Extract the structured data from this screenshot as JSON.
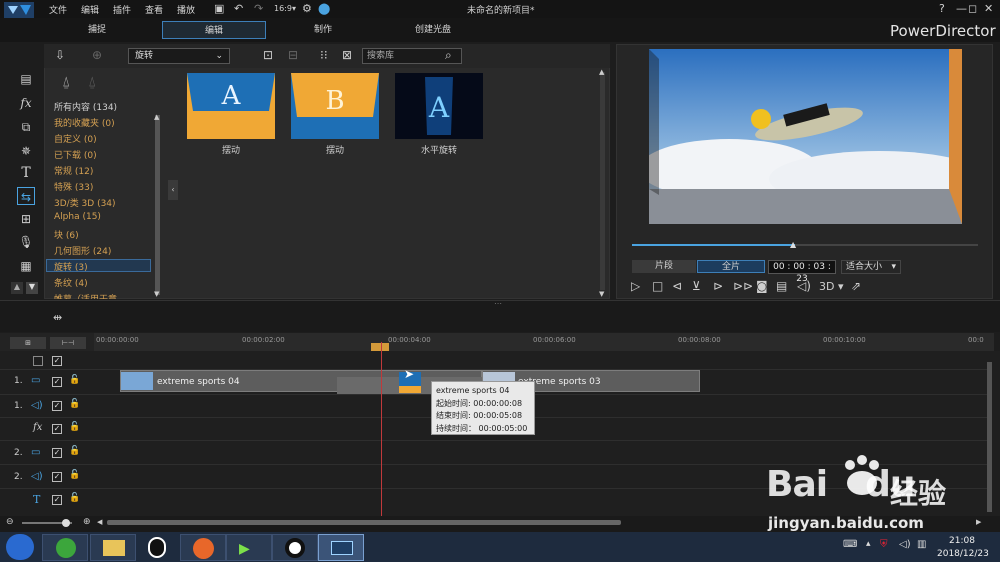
{
  "menu": [
    "文件",
    "编辑",
    "插件",
    "查看",
    "播放"
  ],
  "window": {
    "title": "未命名的新项目*",
    "buttons": [
      "?",
      "—",
      "◻",
      "✕"
    ]
  },
  "modes": [
    "捕捉",
    "编辑",
    "制作",
    "创建光盘"
  ],
  "brand": "PowerDirector",
  "library": {
    "category_select": "旋转",
    "search_placeholder": "搜索库",
    "categories": [
      "所有内容 (134)",
      "我的收藏夹 (0)",
      "自定义 (0)",
      "已下载 (0)",
      "常规 (12)",
      "特殊 (33)",
      "3D/类 3D (34)",
      "Alpha (15)",
      "块 (6)",
      "几何图形 (24)",
      "旋转 (3)",
      "条纹 (4)",
      "帷幕（适用于章"
    ],
    "thumbs": [
      {
        "label": "摆动",
        "letter": "A"
      },
      {
        "label": "摆动",
        "letter": "B"
      },
      {
        "label": "水平旋转",
        "letter": "A"
      }
    ]
  },
  "preview": {
    "clip_btn": "片段",
    "full_btn": "全片",
    "timecode": "00 : 00 : 03 : 23",
    "fit": "适合大小",
    "mode3d": "3D",
    "progress": 0.47
  },
  "timeline": {
    "ticks": [
      "00:00:00:00",
      "00:00:02:00",
      "00:00:04:00",
      "00:00:06:00",
      "00:00:08:00",
      "00:00:10:00",
      "00:0"
    ],
    "tracks": [
      "1.",
      "1.",
      "",
      "2.",
      "2.",
      ""
    ],
    "clips": [
      "extreme sports 04",
      "extreme sports 03"
    ],
    "tooltip": {
      "name": "extreme sports 04",
      "start": "起始时间: 00:00:00:08",
      "end": "结束时间: 00:00:05:08",
      "duration": "持续时间： 00:00:05:00"
    }
  },
  "taskbar": {
    "time": "21:08",
    "date": "2018/12/23"
  },
  "watermark": {
    "brand": "Bai",
    "brand2": "du",
    "cn": "经验",
    "url": "jingyan.baidu.com"
  }
}
